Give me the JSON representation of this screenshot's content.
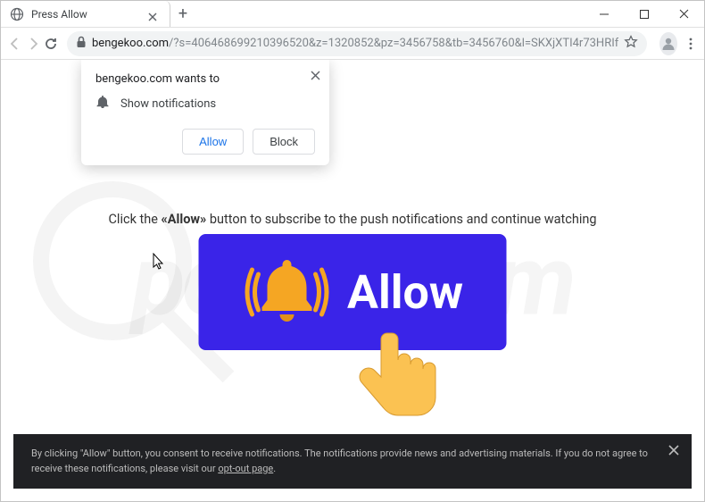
{
  "window": {
    "tab_title": "Press Allow"
  },
  "toolbar": {
    "url_host": "bengekoo.com",
    "url_path": "/?s=406468699210396520&z=1320852&pz=3456758&tb=3456760&l=SKXjXTI4r73HRIf"
  },
  "notification": {
    "wants_to": "bengekoo.com wants to",
    "show_notifications": "Show notifications",
    "allow_label": "Allow",
    "block_label": "Block"
  },
  "page": {
    "instruction_pre": "Click the ",
    "instruction_bold": "«Allow»",
    "instruction_post": " button to subscribe to the push notifications and continue watching",
    "big_button_label": "Allow"
  },
  "consent": {
    "text_pre": "By clicking \"Allow\" button, you consent to receive notifications. The notifications provide news and advertising materials. If you do not agree to receive these notifications, please visit our ",
    "link": "opt-out page",
    "text_post": "."
  },
  "watermark": {
    "text": "pcrisk.com"
  }
}
